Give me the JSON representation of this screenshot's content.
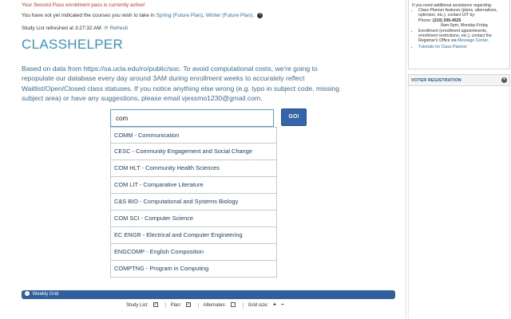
{
  "notices": {
    "second_pass": "Your Second Pass enrollment pass is currently active!",
    "plan_prefix": "You have not yet indicated the courses you wish to take in",
    "plan_spring": "Spring (Future Plan)",
    "plan_sep": ",",
    "plan_winter": "Winter (Future Plan)",
    "plan_suffix": ".",
    "help_glyph": "?"
  },
  "refresh": {
    "text": "Study List refreshed at 3:27:32 AM.",
    "icon": "refresh-icon",
    "link": "Refresh"
  },
  "app": {
    "title": "CLASSHELPER"
  },
  "description": "Based on data from https://sa.ucla.edu/ro/public/soc. To avoid computational costs, we're going to repopulate our database every day around 3AM during enrollment weeks to accurately reflect Waitlist/Open/Closed class statuses. If you notice anything else wrong (e.g. typo in subject code, missing subject area) or have any suggestions, please email vjessmo1230@gmail.com.",
  "search": {
    "value": "com",
    "go_label": "GO!"
  },
  "suggestions": [
    "COMM - Communication",
    "CESC - Community Engagement and Social Change",
    "COM HLT - Community Health Sciences",
    "COM LIT - Comparative Literature",
    "C&S BIO - Computational and Systems Biology",
    "COM SCI - Computer Science",
    "EC ENGR - Electrical and Computer Engineering",
    "ENGCOMP - English Composition",
    "COMPTNG - Program in Computing"
  ],
  "weekly_grid": {
    "label": "Weekly Grid",
    "icon": "minus-circle-icon"
  },
  "toggles": {
    "study_list": "Study List:",
    "plan": "Plan:",
    "alternates": "Alternates:",
    "grid_size": "Grid size:",
    "check": "✓",
    "sep": "|",
    "plus": "+",
    "minus": "−"
  },
  "sidebar": {
    "intro": "If you need additional assistance regarding:",
    "item1": "Class Planner features (plans, alternatives, optimizer, etc.), contact UIT by:",
    "phone_label": "Phone:",
    "phone": "(310) 206-4525",
    "hours": "8am-5pm, Monday-Friday",
    "item2_prefix": "Enrollment (enrollment appointments, enrollment restrictions, etc.), contact the Registrar's Office via",
    "item2_link": "Message Center",
    "item2_suffix": ".",
    "item3": "Tutorials for Class Planner",
    "voter_label": "VOTER REGISTRATION",
    "voter_icon": "plus-circle-icon",
    "plus_glyph": "+"
  },
  "colors": {
    "title": "#3a93c4",
    "link": "#2a6fb0",
    "go_button": "#3564a8",
    "grid_bar": "#2f5f9c",
    "alert": "#c0392b"
  }
}
